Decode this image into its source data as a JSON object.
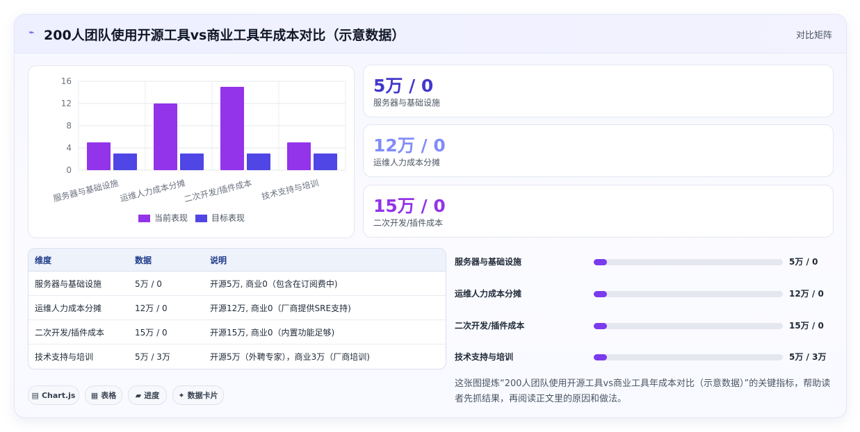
{
  "header": {
    "title": "200人团队使用开源工具vs商业工具年成本对比（示意数据）",
    "tag": "对比矩阵",
    "trend_icon": "trend-icon"
  },
  "colors": {
    "series1": "#9333ea",
    "series2": "#4f46e5",
    "stat1": "#4338ca",
    "stat2": "#818cf8",
    "stat3": "#9333ea"
  },
  "chart_data": {
    "type": "bar",
    "categories": [
      "服务器与基础设施",
      "运维人力成本分摊",
      "二次开发/插件成本",
      "技术支持与培训"
    ],
    "series": [
      {
        "name": "当前表现",
        "values": [
          5,
          12,
          15,
          5
        ]
      },
      {
        "name": "目标表现",
        "values": [
          3,
          3,
          3,
          3
        ]
      }
    ],
    "yticks": [
      "0",
      "4",
      "8",
      "12",
      "16"
    ],
    "ylim": [
      0,
      16
    ],
    "grid": true,
    "legend_position": "bottom"
  },
  "stats": [
    {
      "value": "5万 / 0",
      "label": "服务器与基础设施"
    },
    {
      "value": "12万 / 0",
      "label": "运维人力成本分摊"
    },
    {
      "value": "15万 / 0",
      "label": "二次开发/插件成本"
    }
  ],
  "table": {
    "headers": [
      "维度",
      "数据",
      "说明"
    ],
    "rows": [
      [
        "服务器与基础设施",
        "5万 / 0",
        "开源5万, 商业0（包含在订阅费中)"
      ],
      [
        "运维人力成本分摊",
        "12万 / 0",
        "开源12万, 商业0（厂商提供SRE支持)"
      ],
      [
        "二次开发/插件成本",
        "15万 / 0",
        "开源15万, 商业0（内置功能足够)"
      ],
      [
        "技术支持与培训",
        "5万 / 3万",
        "开源5万（外聘专家），商业3万（厂商培训)"
      ]
    ]
  },
  "progress": [
    {
      "label": "服务器与基础设施",
      "value": "5万 / 0",
      "fraction": 0.07
    },
    {
      "label": "运维人力成本分摊",
      "value": "12万 / 0",
      "fraction": 0.07
    },
    {
      "label": "二次开发/插件成本",
      "value": "15万 / 0",
      "fraction": 0.07
    },
    {
      "label": "技术支持与培训",
      "value": "5万 / 3万",
      "fraction": 0.07
    }
  ],
  "pills": [
    {
      "icon": "▤",
      "label": "Chart.js"
    },
    {
      "icon": "▦",
      "label": "表格"
    },
    {
      "icon": "▰",
      "label": "进度"
    },
    {
      "icon": "✦",
      "label": "数据卡片"
    }
  ],
  "note": "这张图提炼“200人团队使用开源工具vs商业工具年成本对比（示意数据）”的关键指标，帮助读者先抓结果，再阅读正文里的原因和做法。"
}
